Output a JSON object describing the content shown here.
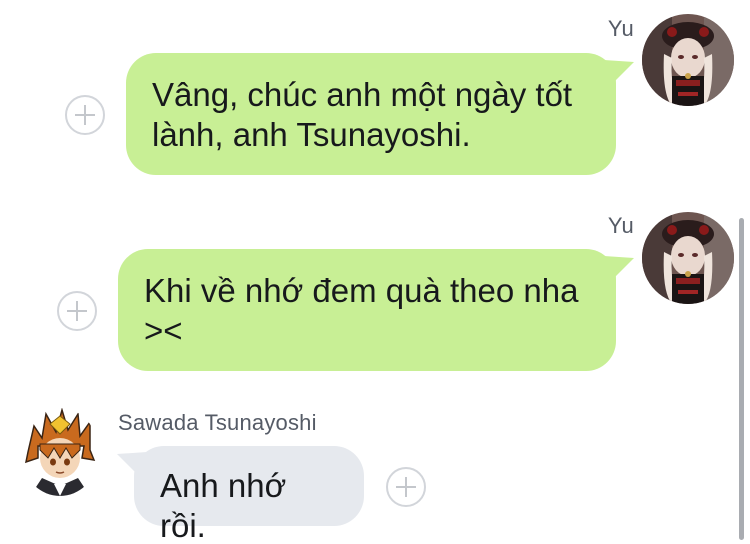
{
  "messages": [
    {
      "sender": "Yu",
      "direction": "outgoing",
      "lines": [
        "Vâng, chúc anh một ngày tốt",
        "lành, anh Tsunayoshi."
      ]
    },
    {
      "sender": "Yu",
      "direction": "outgoing",
      "lines": [
        "Khi về nhớ đem quà theo nha",
        "><"
      ]
    },
    {
      "sender": "Sawada Tsunayoshi",
      "direction": "incoming",
      "lines": [
        "Anh nhớ rồi."
      ]
    }
  ],
  "colors": {
    "outgoing_bubble": "#c8ef95",
    "incoming_bubble": "#e6e9ee",
    "sender_name": "#555b66",
    "add_button": "#d2d5da"
  },
  "icons": {
    "add": "plus-icon",
    "avatar_yu": "avatar-gothic-girl",
    "avatar_tsunayoshi": "avatar-spiky-orange-hair"
  }
}
